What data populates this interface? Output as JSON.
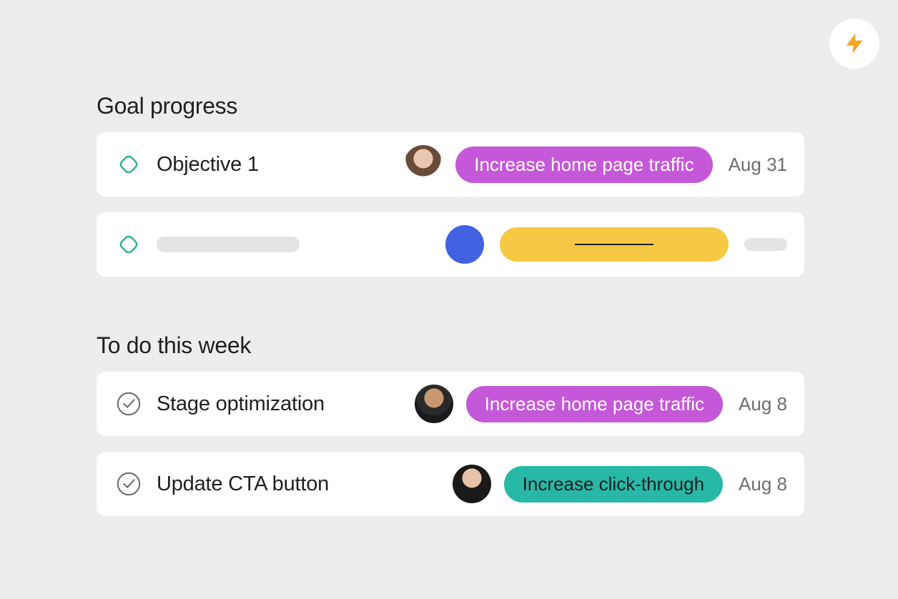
{
  "fab": {
    "icon": "lightning-icon"
  },
  "colors": {
    "purple": "#c558d8",
    "teal": "#28b8a6",
    "yellow": "#f6c944",
    "blue": "#4262e2",
    "goal_outline": "#27ae8f",
    "check_outline": "#6d6e6f"
  },
  "sections": {
    "goals": {
      "title": "Goal progress",
      "items": [
        {
          "icon": "goal-diamond-icon",
          "title": "Objective 1",
          "avatar": "avatar-1",
          "tag": {
            "label": "Increase home page traffic",
            "color": "purple"
          },
          "date": "Aug 31"
        },
        {
          "icon": "goal-diamond-icon",
          "placeholder": true,
          "avatar_color": "blue",
          "tag_color": "yellow"
        }
      ]
    },
    "todo": {
      "title": "To do this week",
      "items": [
        {
          "icon": "checkmark-circle-icon",
          "title": "Stage optimization",
          "avatar": "avatar-2",
          "tag": {
            "label": "Increase home page traffic",
            "color": "purple"
          },
          "date": "Aug 8"
        },
        {
          "icon": "checkmark-circle-icon",
          "title": "Update CTA button",
          "avatar": "avatar-3",
          "tag": {
            "label": "Increase click-through",
            "color": "teal"
          },
          "date": "Aug 8"
        }
      ]
    }
  }
}
